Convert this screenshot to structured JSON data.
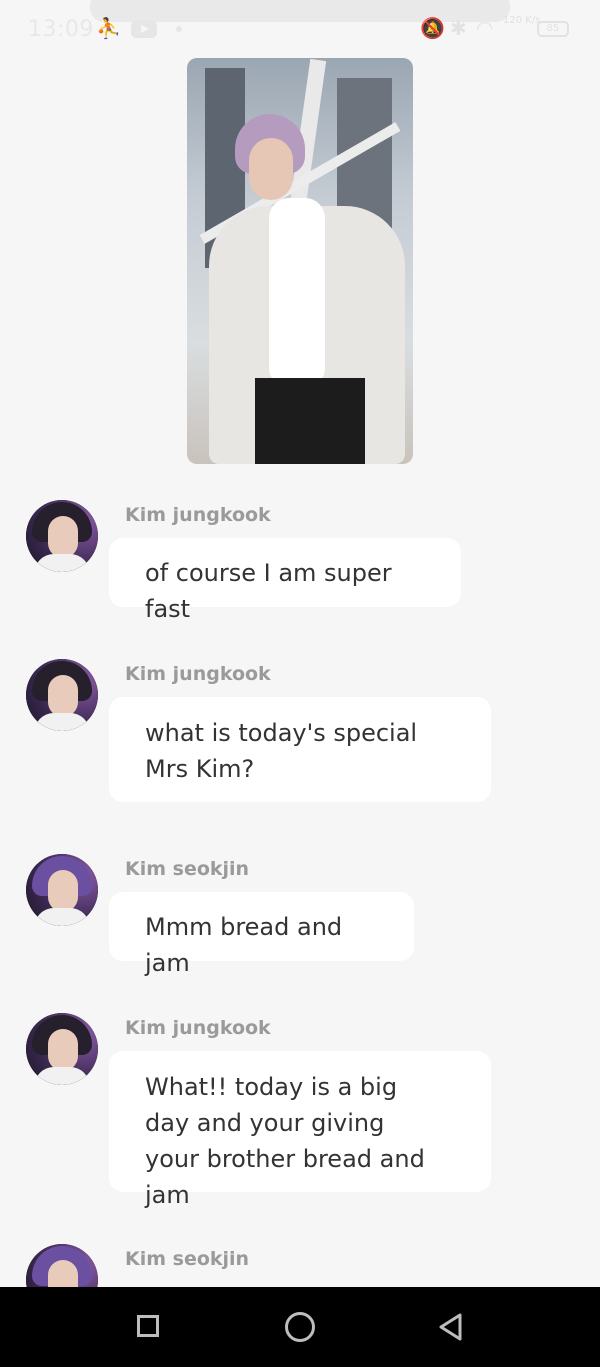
{
  "status_bar": {
    "time": "13:09",
    "network_speed": "120 K/s",
    "battery": "85"
  },
  "messages": [
    {
      "sender": "Kim jungkook",
      "text": "of course I am super fast",
      "avatar": "jungkook"
    },
    {
      "sender": "Kim jungkook",
      "text": "what is today's special Mrs Kim?",
      "avatar": "jungkook"
    },
    {
      "sender": "Kim seokjin",
      "text": "Mmm bread and jam",
      "avatar": "seokjin"
    },
    {
      "sender": "Kim jungkook",
      "text": "What!! today is a big day and your giving your brother bread and jam",
      "avatar": "jungkook"
    },
    {
      "sender": "Kim seokjin",
      "text": "",
      "avatar": "seokjin"
    }
  ]
}
